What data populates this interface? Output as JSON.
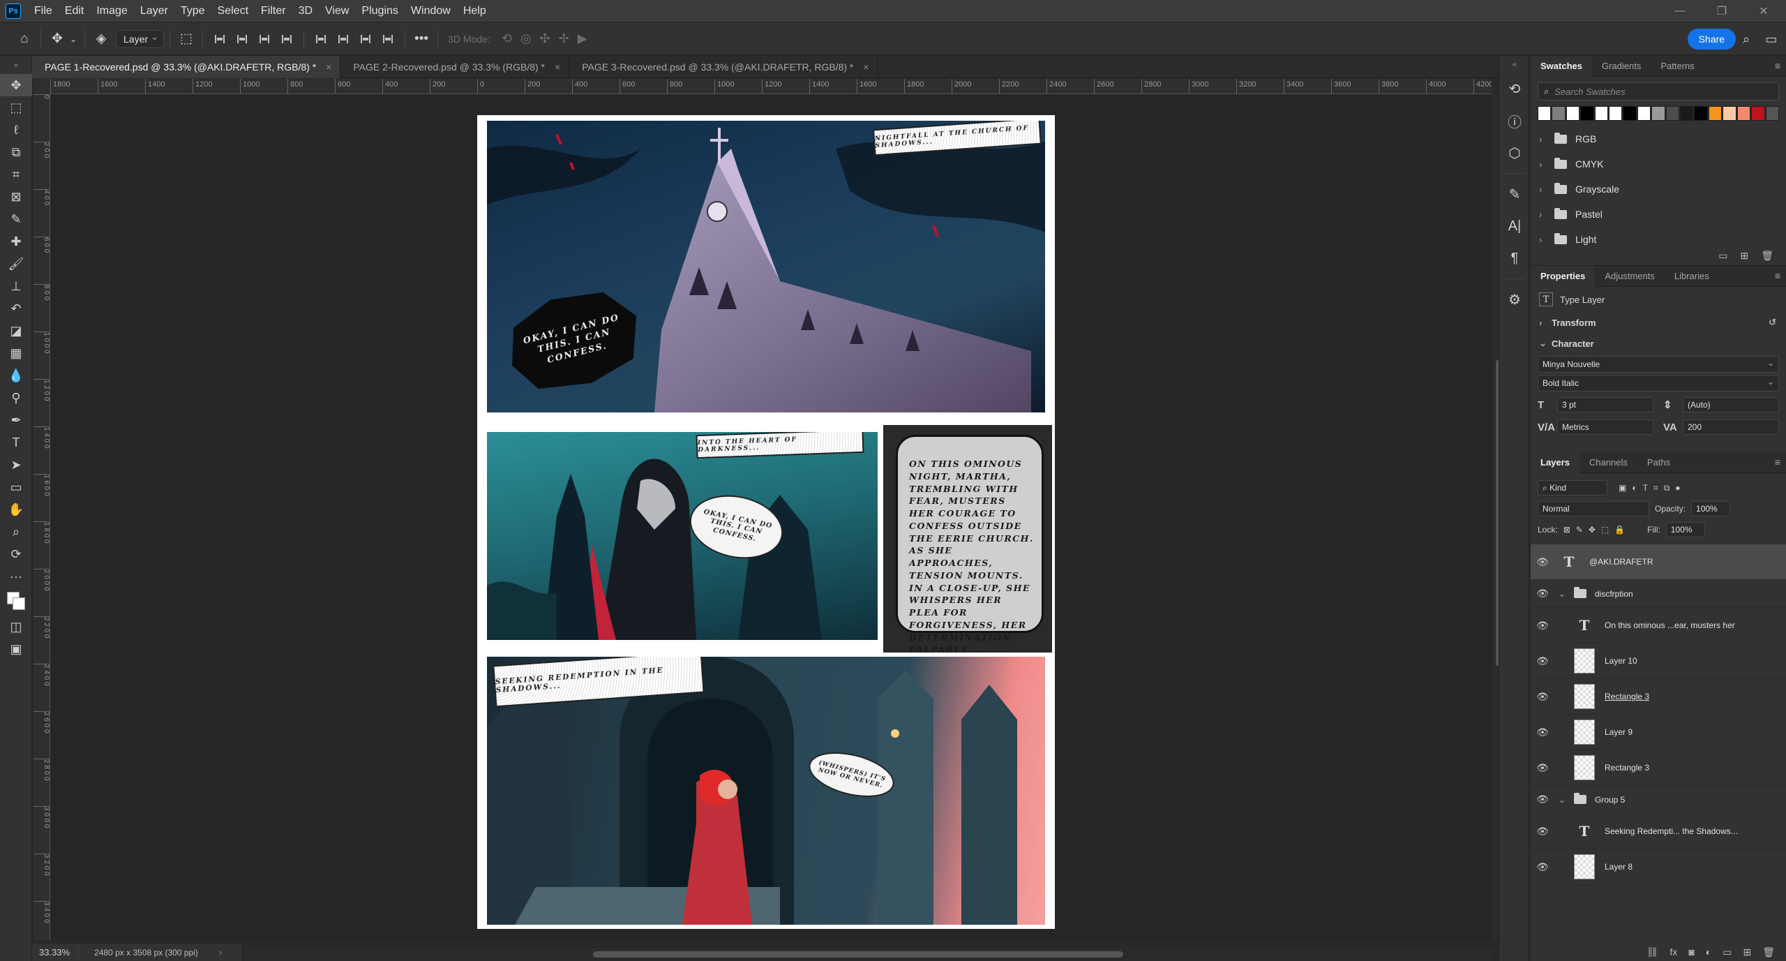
{
  "app": {
    "logo": "Ps"
  },
  "menu": [
    "File",
    "Edit",
    "Image",
    "Layer",
    "Type",
    "Select",
    "Filter",
    "3D",
    "View",
    "Plugins",
    "Window",
    "Help"
  ],
  "options": {
    "target": "Layer",
    "mode_label": "3D Mode:",
    "share": "Share"
  },
  "tabs": [
    "PAGE 1-Recovered.psd @ 33.3% (@AKI.DRAFETR, RGB/8) *",
    "PAGE 2-Recovered.psd @ 33.3% (RGB/8) *",
    "PAGE 3-Recovered.psd @ 33.3% (@AKI.DRAFETR, RGB/8) *"
  ],
  "ruler_top": [
    "1800",
    "1600",
    "1400",
    "1200",
    "1000",
    "800",
    "600",
    "400",
    "200",
    "0",
    "200",
    "400",
    "600",
    "800",
    "1000",
    "1200",
    "1400",
    "1600",
    "1800",
    "2000",
    "2200",
    "2400",
    "2600",
    "2800",
    "3000",
    "3200",
    "3400",
    "3600",
    "3800",
    "4000",
    "4200"
  ],
  "ruler_left": [
    "0",
    "2 0 0",
    "4 0 0",
    "6 0 0",
    "8 0 0",
    "1 0 0 0",
    "1 2 0 0",
    "1 4 0 0",
    "1 6 0 0",
    "1 8 0 0",
    "2 0 0 0",
    "2 2 0 0",
    "2 4 0 0",
    "2 6 0 0",
    "2 8 0 0",
    "3 0 0 0",
    "3 2 0 0",
    "3 4 0 0"
  ],
  "comic": {
    "caption1": "NIGHTFALL AT THE CHURCH OF SHADOWS...",
    "bubble1": "OKAY, I CAN DO THIS. I CAN CONFESS.",
    "caption2": "INTO THE HEART OF DARKNESS...",
    "bubble2": "OKAY, I CAN DO THIS. I CAN CONFESS.",
    "narration": "ON THIS OMINOUS NIGHT, MARTHA, TREMBLING WITH FEAR, MUSTERS HER COURAGE TO CONFESS OUTSIDE THE EERIE CHURCH. AS SHE APPROACHES, TENSION MOUNTS. IN A CLOSE-UP, SHE WHISPERS HER PLEA FOR FORGIVENESS, HER DETERMINATION PALPABLE..........",
    "caption3": "SEEKING REDEMPTION IN THE SHADOWS...",
    "bubble3": "(WHISPERS) IT'S NOW OR NEVER."
  },
  "status": {
    "zoom": "33.33%",
    "info": "2480 px x 3508 px (300 ppi)"
  },
  "swatches": {
    "tabs": [
      "Swatches",
      "Gradients",
      "Patterns"
    ],
    "search_placeholder": "Search Swatches",
    "colors": [
      "#ffffff",
      "#7f7f7f",
      "#ffffff",
      "#000000",
      "#ffffff",
      "#ffffff",
      "#000000",
      "#ffffff",
      "#9a9a9a",
      "#4d4d4d",
      "#1a1a1a",
      "#000000",
      "#f7941d",
      "#f9c9a4",
      "#f48a6b",
      "#c1121f",
      "#555555"
    ],
    "folders": [
      "RGB",
      "CMYK",
      "Grayscale",
      "Pastel",
      "Light"
    ]
  },
  "properties": {
    "tabs": [
      "Properties",
      "Adjustments",
      "Libraries"
    ],
    "layer_type": "Type Layer",
    "transform": "Transform",
    "character": "Character",
    "font": "Minya Nouvelle",
    "style": "Bold Italic",
    "size": "3 pt",
    "leading": "(Auto)",
    "kerning": "Metrics",
    "tracking": "200"
  },
  "layers": {
    "tabs": [
      "Layers",
      "Channels",
      "Paths"
    ],
    "kind": "Kind",
    "blend": "Normal",
    "opacity_label": "Opacity:",
    "opacity": "100%",
    "lock_label": "Lock:",
    "fill_label": "Fill:",
    "fill": "100%",
    "items": [
      {
        "name": "@AKI.DRAFETR",
        "kind": "type"
      },
      {
        "name": "discfrption",
        "kind": "group"
      },
      {
        "name": "On this ominous ...ear, musters her",
        "kind": "type"
      },
      {
        "name": "Layer 10",
        "kind": "pixel"
      },
      {
        "name": "Rectangle 3",
        "kind": "shape"
      },
      {
        "name": "Layer 9",
        "kind": "pixel"
      },
      {
        "name": "Rectangle 3",
        "kind": "shape"
      },
      {
        "name": "Group 5",
        "kind": "group"
      },
      {
        "name": "Seeking Redempti... the Shadows...",
        "kind": "type"
      },
      {
        "name": "Layer 8",
        "kind": "pixel"
      }
    ]
  }
}
